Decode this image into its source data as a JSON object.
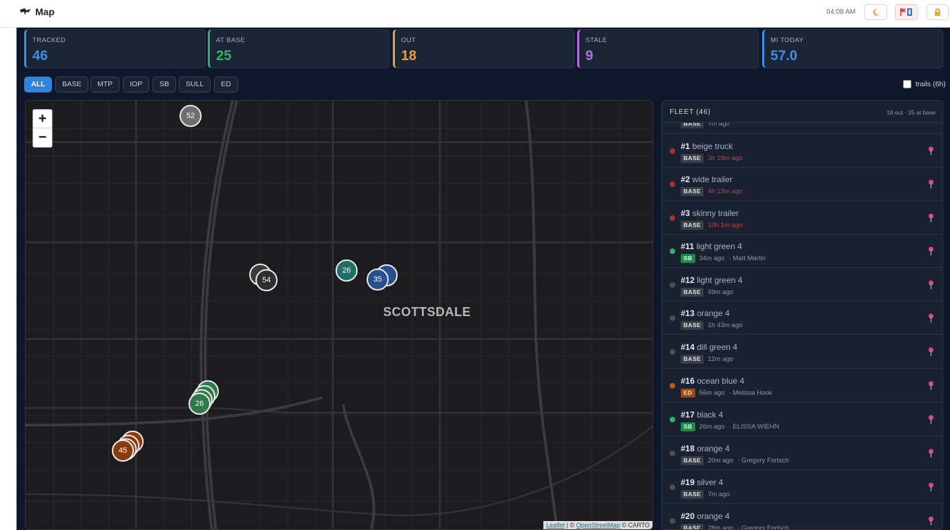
{
  "header": {
    "title": "Map",
    "clock": "04:08 AM"
  },
  "stats": [
    {
      "label": "TRACKED",
      "value": "46",
      "color": "#3b8fe8"
    },
    {
      "label": "AT BASE",
      "value": "25",
      "color": "#2fb36a"
    },
    {
      "label": "OUT",
      "value": "18",
      "color": "#e8a33b"
    },
    {
      "label": "STALE",
      "value": "9",
      "color": "#b46ee8"
    },
    {
      "label": "MI TODAY",
      "value": "57.0",
      "color": "#3b8fe8"
    }
  ],
  "filters": [
    "ALL",
    "BASE",
    "MTP",
    "IOP",
    "SB",
    "SULL",
    "ED"
  ],
  "active_filter": "ALL",
  "trails_label": "trails (6h)",
  "map": {
    "zoom_in": "+",
    "zoom_out": "−",
    "city_label": "SCOTTSDALE",
    "markers": [
      "52",
      "54",
      "26",
      "35",
      "26",
      "45"
    ],
    "attribution": {
      "leaflet": "Leaflet",
      "sep": "| ©",
      "osm": "OpenStreetMap",
      "carto": "© CARTO"
    }
  },
  "fleet": {
    "title": "FLEET (46)",
    "summary": "18 out · 25 at base",
    "partial_row": {
      "status": "BASE",
      "time": "7m ago"
    },
    "rows": [
      {
        "num": "#1",
        "name": "beige truck",
        "status": "BASE",
        "time": "3h 18m ago",
        "driver": "",
        "dot": "#a8322f",
        "stale": true
      },
      {
        "num": "#2",
        "name": "wide trailer",
        "status": "BASE",
        "time": "4h 13m ago",
        "driver": "",
        "dot": "#a8322f",
        "stale": true
      },
      {
        "num": "#3",
        "name": "skinny trailer",
        "status": "BASE",
        "time": "10h 1m ago",
        "driver": "",
        "dot": "#a8322f",
        "stale": true
      },
      {
        "num": "#11",
        "name": "light green 4",
        "status": "SB",
        "time": "34m ago",
        "driver": "· Matt Martin",
        "dot": "#2fb36a",
        "stale": false
      },
      {
        "num": "#12",
        "name": "light green 4",
        "status": "BASE",
        "time": "49m ago",
        "driver": "",
        "dot": "#4a4f58",
        "stale": false
      },
      {
        "num": "#13",
        "name": "orange 4",
        "status": "BASE",
        "time": "1h 43m ago",
        "driver": "",
        "dot": "#4a4f58",
        "stale": false
      },
      {
        "num": "#14",
        "name": "dill green 4",
        "status": "BASE",
        "time": "12m ago",
        "driver": "",
        "dot": "#4a4f58",
        "stale": false
      },
      {
        "num": "#16",
        "name": "ocean blue 4",
        "status": "ED",
        "time": "56m ago",
        "driver": "· Melissa Hook",
        "dot": "#c05a14",
        "stale": false
      },
      {
        "num": "#17",
        "name": "black 4",
        "status": "SB",
        "time": "26m ago",
        "driver": "· ELISSA WIEHN",
        "dot": "#2fb36a",
        "stale": false
      },
      {
        "num": "#18",
        "name": "orange 4",
        "status": "BASE",
        "time": "20m ago",
        "driver": "· Gregory Fortsch",
        "dot": "#4a4f58",
        "stale": false
      },
      {
        "num": "#19",
        "name": "silver 4",
        "status": "BASE",
        "time": "7m ago",
        "driver": "",
        "dot": "#4a4f58",
        "stale": false
      },
      {
        "num": "#20",
        "name": "orange 4",
        "status": "BASE",
        "time": "28m ago",
        "driver": "· Gregory Fortsch",
        "dot": "#4a4f58",
        "stale": false
      }
    ]
  }
}
